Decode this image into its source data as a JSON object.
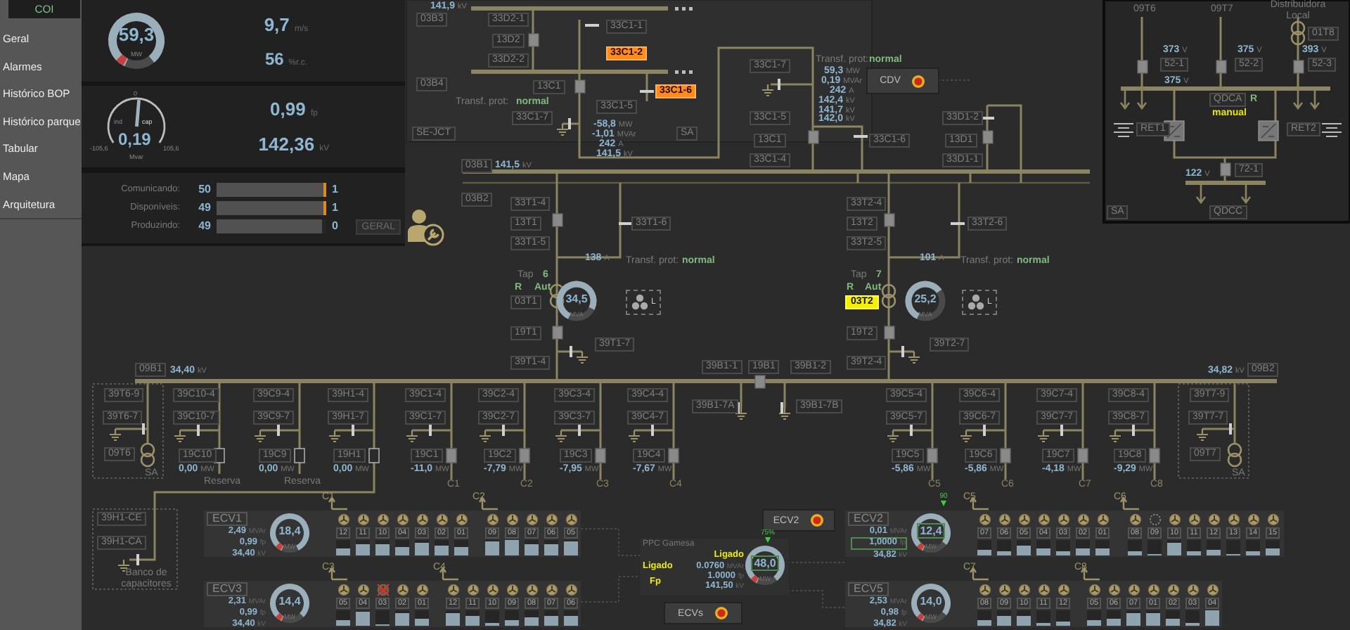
{
  "sidebar": {
    "items": [
      {
        "label": "COI",
        "selected": true
      },
      {
        "label": "Geral",
        "selected": false
      },
      {
        "label": "Alarmes",
        "selected": false
      },
      {
        "label": "Histórico BOP",
        "selected": false
      },
      {
        "label": "Histórico parque",
        "selected": false
      },
      {
        "label": "Tabular",
        "selected": false
      },
      {
        "label": "Mapa",
        "selected": false
      },
      {
        "label": "Arquitetura",
        "selected": false
      }
    ]
  },
  "summary": {
    "power": {
      "value": "59,3",
      "unit": "MW",
      "level": 0.82
    },
    "wind": {
      "value": "9,7",
      "unit": "m/s"
    },
    "capacity": {
      "value": "56",
      "unit": "%r.c."
    },
    "reactive": {
      "value": "0,19",
      "unit": "Mvar",
      "level": 0.52,
      "scale_mid": "0",
      "scale_min": "-105,6",
      "scale_max": "105,6",
      "left_label": "ind",
      "right_label": "cap"
    },
    "power_factor": {
      "value": "0,99",
      "unit": "fp"
    },
    "voltage": {
      "value": "142,36",
      "unit": "kV"
    },
    "turbines": [
      {
        "label": "Comunicando:",
        "count": "50",
        "level": 0.97,
        "alert": true,
        "other": "1"
      },
      {
        "label": "Disponíveis:",
        "count": "49",
        "level": 0.97,
        "alert": true,
        "other": "1"
      },
      {
        "label": "Produzindo:",
        "count": "49",
        "level": 0.96,
        "alert": false,
        "other": "0"
      }
    ],
    "button": "GERAL"
  },
  "diagram": {
    "items": [
      {
        "kind": "value",
        "text": "141,9",
        "unit": "kV"
      },
      {
        "kind": "tag",
        "text": "03B3"
      },
      {
        "kind": "tag",
        "text": "33D2-1"
      },
      {
        "kind": "tag",
        "text": "13D2"
      },
      {
        "kind": "tag",
        "text": "33D2-2"
      },
      {
        "kind": "tag",
        "text": "33C1-1"
      },
      {
        "kind": "alarm",
        "text": "33C1-2"
      },
      {
        "kind": "tag",
        "text": "03B4"
      },
      {
        "kind": "tag",
        "text": "13C1"
      },
      {
        "kind": "alarm",
        "text": "33C1-6"
      },
      {
        "kind": "caption",
        "text": "Transf. prot:"
      },
      {
        "kind": "status",
        "text": "normal"
      },
      {
        "kind": "tag",
        "text": "33C1-5"
      },
      {
        "kind": "tag",
        "text": "33C1-7"
      },
      {
        "kind": "value",
        "text": "-58,8",
        "unit": "MW"
      },
      {
        "kind": "value",
        "text": "-1,01",
        "unit": "MVAr"
      },
      {
        "kind": "value",
        "text": "242",
        "unit": "A"
      },
      {
        "kind": "value",
        "text": "141,5",
        "unit": "kV"
      },
      {
        "kind": "tag",
        "text": "SE-JCT"
      },
      {
        "kind": "tag",
        "text": "SA"
      },
      {
        "kind": "tag",
        "text": "03B1"
      },
      {
        "kind": "value",
        "text": "141,5",
        "unit": "kV"
      },
      {
        "kind": "caption",
        "text": "Transf. prot:"
      },
      {
        "kind": "status",
        "text": "normal"
      },
      {
        "kind": "tag",
        "text": "33C1-7"
      },
      {
        "kind": "value",
        "text": "59,3",
        "unit": "MW"
      },
      {
        "kind": "value",
        "text": "0,19",
        "unit": "MVAr"
      },
      {
        "kind": "value",
        "text": "242",
        "unit": "A"
      },
      {
        "kind": "value",
        "text": "142,4",
        "unit": "kV"
      },
      {
        "kind": "tag",
        "text": "33C1-5"
      },
      {
        "kind": "value",
        "text": "141,7",
        "unit": "kV"
      },
      {
        "kind": "value",
        "text": "142,0",
        "unit": "kV"
      },
      {
        "kind": "tag",
        "text": "33D1-2"
      },
      {
        "kind": "tag",
        "text": "13C1"
      },
      {
        "kind": "tag",
        "text": "33C1-6"
      },
      {
        "kind": "tag",
        "text": "13D1"
      },
      {
        "kind": "tag",
        "text": "33C1-4"
      },
      {
        "kind": "tag",
        "text": "33D1-1"
      },
      {
        "kind": "caption",
        "text": "09T6"
      },
      {
        "kind": "caption",
        "text": "09T7"
      },
      {
        "kind": "caption",
        "text": "Distribuidora Local"
      },
      {
        "kind": "tag",
        "text": "01T8"
      },
      {
        "kind": "value",
        "text": "373",
        "unit": "V"
      },
      {
        "kind": "value",
        "text": "375",
        "unit": "V"
      },
      {
        "kind": "value",
        "text": "393",
        "unit": "V"
      },
      {
        "kind": "tag",
        "text": "52-1"
      },
      {
        "kind": "tag",
        "text": "52-2"
      },
      {
        "kind": "tag",
        "text": "52-3"
      },
      {
        "kind": "value",
        "text": "375",
        "unit": "V"
      },
      {
        "kind": "tag",
        "text": "QDCA"
      },
      {
        "kind": "status",
        "text": "R"
      },
      {
        "kind": "mode",
        "text": "manual"
      },
      {
        "kind": "tag",
        "text": "RET1"
      },
      {
        "kind": "tag",
        "text": "RET2"
      },
      {
        "kind": "value",
        "text": "122",
        "unit": "V"
      },
      {
        "kind": "tag",
        "text": "72-1"
      },
      {
        "kind": "tag",
        "text": "SA"
      },
      {
        "kind": "tag",
        "text": "QDCC"
      },
      {
        "kind": "tag",
        "text": "03B2"
      },
      {
        "kind": "tag",
        "text": "33T1-4"
      },
      {
        "kind": "tag",
        "text": "13T1"
      },
      {
        "kind": "tag",
        "text": "33T1-6"
      },
      {
        "kind": "tag",
        "text": "33T1-5"
      },
      {
        "kind": "value",
        "text": "138",
        "unit": "A"
      },
      {
        "kind": "caption",
        "text": "Transf. prot:"
      },
      {
        "kind": "status",
        "text": "normal"
      },
      {
        "kind": "caption",
        "text": "Tap"
      },
      {
        "kind": "status",
        "text": "6"
      },
      {
        "kind": "status",
        "text": "R"
      },
      {
        "kind": "status",
        "text": "Aut"
      },
      {
        "kind": "tag",
        "text": "03T1"
      },
      {
        "kind": "tag",
        "text": "19T1"
      },
      {
        "kind": "tag",
        "text": "39T1-7"
      },
      {
        "kind": "tag",
        "text": "39T1-4"
      },
      {
        "kind": "tag",
        "text": "33T2-4"
      },
      {
        "kind": "tag",
        "text": "13T2"
      },
      {
        "kind": "tag",
        "text": "33T2-6"
      },
      {
        "kind": "tag",
        "text": "33T2-5"
      },
      {
        "kind": "value",
        "text": "101",
        "unit": "A"
      },
      {
        "kind": "caption",
        "text": "Transf. prot:"
      },
      {
        "kind": "status",
        "text": "normal"
      },
      {
        "kind": "caption",
        "text": "Tap"
      },
      {
        "kind": "status",
        "text": "7"
      },
      {
        "kind": "status",
        "text": "R"
      },
      {
        "kind": "status",
        "text": "Aut"
      },
      {
        "kind": "highlight",
        "text": "03T2"
      },
      {
        "kind": "tag",
        "text": "19T2"
      },
      {
        "kind": "tag",
        "text": "39T2-7"
      },
      {
        "kind": "tag",
        "text": "39T2-4"
      },
      {
        "kind": "tag",
        "text": "09B1"
      },
      {
        "kind": "value",
        "text": "34,40",
        "unit": "kV"
      },
      {
        "kind": "tag",
        "text": "39B1-1"
      },
      {
        "kind": "tag",
        "text": "19B1"
      },
      {
        "kind": "tag",
        "text": "39B1-2"
      },
      {
        "kind": "value",
        "text": "34,82",
        "unit": "kV"
      },
      {
        "kind": "tag",
        "text": "09B2"
      },
      {
        "kind": "tag",
        "text": "39T6-9"
      },
      {
        "kind": "tag",
        "text": "39T6-7"
      },
      {
        "kind": "tag",
        "text": "09T6"
      },
      {
        "kind": "caption",
        "text": "SA"
      },
      {
        "kind": "tag",
        "text": "39B1-7A"
      },
      {
        "kind": "tag",
        "text": "39B1-7B"
      },
      {
        "kind": "tag",
        "text": "39T7-9"
      },
      {
        "kind": "tag",
        "text": "39T7-7"
      },
      {
        "kind": "tag",
        "text": "09T7"
      },
      {
        "kind": "caption",
        "text": "SA"
      },
      {
        "kind": "tag",
        "text": "39H1-CE"
      },
      {
        "kind": "tag",
        "text": "39H1-CA"
      },
      {
        "kind": "caption",
        "text": "Banco de capacitores"
      }
    ],
    "feeders": [
      {
        "tags": [
          "39C10-4",
          "39C10-7",
          "19C10"
        ],
        "reading": {
          "value": "0,00",
          "unit": "MW"
        },
        "closed": false,
        "note": "Reserva"
      },
      {
        "tags": [
          "39C9-4",
          "39C9-7",
          "19C9"
        ],
        "reading": {
          "value": "0,00",
          "unit": "MW"
        },
        "closed": false,
        "note": "Reserva"
      },
      {
        "tags": [
          "39H1-4",
          "39H1-7",
          "19H1"
        ],
        "reading": {
          "value": "0,00",
          "unit": "MW"
        },
        "closed": false
      },
      {
        "tags": [
          "39C1-4",
          "39C1-7",
          "19C1"
        ],
        "reading": {
          "value": "-11,0",
          "unit": "MW"
        },
        "closed": true,
        "bay": "C1"
      },
      {
        "tags": [
          "39C2-4",
          "39C2-7",
          "19C2"
        ],
        "reading": {
          "value": "-7,79",
          "unit": "MW"
        },
        "closed": true,
        "bay": "C2"
      },
      {
        "tags": [
          "39C3-4",
          "39C3-7",
          "19C3"
        ],
        "reading": {
          "value": "-7,95",
          "unit": "MW"
        },
        "closed": true,
        "bay": "C3"
      },
      {
        "tags": [
          "39C4-4",
          "39C4-7",
          "19C4"
        ],
        "reading": {
          "value": "-7,67",
          "unit": "MW"
        },
        "closed": true,
        "bay": "C4"
      },
      {
        "tags": [
          "39C5-4",
          "39C5-7",
          "19C5"
        ],
        "reading": {
          "value": "-5,86",
          "unit": "MW"
        },
        "closed": true,
        "bay": "C5"
      },
      {
        "tags": [
          "39C6-4",
          "39C6-7",
          "19C6"
        ],
        "reading": {
          "value": "-5,86",
          "unit": "MW"
        },
        "closed": true,
        "bay": "C6"
      },
      {
        "tags": [
          "39C7-4",
          "39C7-7",
          "19C7"
        ],
        "reading": {
          "value": "-4,18",
          "unit": "MW"
        },
        "closed": true,
        "bay": "C7"
      },
      {
        "tags": [
          "39C8-4",
          "39C8-7",
          "19C8"
        ],
        "reading": {
          "value": "-9,29",
          "unit": "MW"
        },
        "closed": true,
        "bay": "C8"
      }
    ],
    "transformer_gauges": [
      {
        "value": "34,5",
        "unit": "MVA",
        "level": 0.75
      },
      {
        "value": "25,2",
        "unit": "MVA",
        "level": 0.58
      }
    ],
    "fans": [
      {
        "label": "L"
      },
      {
        "label": "L"
      }
    ],
    "buttons": [
      {
        "label": "CDV"
      },
      {
        "label": "ECV2"
      },
      {
        "label": "ECVs"
      }
    ]
  },
  "ppc": {
    "title": "PPC Gamesa",
    "state": "Ligado",
    "mode_label": "Ligado",
    "control": "Fp",
    "readings": [
      {
        "value": "0.0760",
        "unit": "MVAr"
      },
      {
        "value": "1.0000",
        "unit": "fp"
      },
      {
        "value": "141,50",
        "unit": "kV"
      }
    ],
    "gauge": {
      "value": "48,0",
      "unit": "MW",
      "level": 0.82,
      "setpoint": "75%",
      "controlled": true
    }
  },
  "ecvs": [
    {
      "name": "ECV1",
      "readings": [
        {
          "value": "2,49",
          "unit": "MVAr"
        },
        {
          "value": "0,99",
          "unit": "fp"
        },
        {
          "value": "34,40",
          "unit": "kV"
        }
      ],
      "gauge": {
        "value": "18,4",
        "unit": "MW",
        "level": 0.85,
        "controlled": false
      },
      "groups": [
        {
          "feeder": "C1",
          "turbines": [
            {
              "id": "12",
              "kind": "run",
              "level": 0.5
            },
            {
              "id": "11",
              "kind": "run",
              "level": 0.75
            },
            {
              "id": "10",
              "kind": "run",
              "level": 0.75
            },
            {
              "id": "04",
              "kind": "run",
              "level": 0.55
            },
            {
              "id": "03",
              "kind": "run",
              "level": 0.85
            },
            {
              "id": "02",
              "kind": "run",
              "level": 0.6
            },
            {
              "id": "01",
              "kind": "run",
              "level": 0.55
            }
          ]
        },
        {
          "feeder": "C2",
          "turbines": [
            {
              "id": "09",
              "kind": "run",
              "level": 0.9
            },
            {
              "id": "08",
              "kind": "run",
              "level": 1.0
            },
            {
              "id": "07",
              "kind": "run",
              "level": 0.75
            },
            {
              "id": "06",
              "kind": "run",
              "level": 0.7
            },
            {
              "id": "05",
              "kind": "run",
              "level": 0.9
            }
          ]
        }
      ]
    },
    {
      "name": "ECV2",
      "readings": [
        {
          "value": "0,01",
          "unit": "MVAr",
          "controlled": false
        },
        {
          "value": "1,0000",
          "unit": "fp",
          "controlled": true
        },
        {
          "value": "34,82",
          "unit": "kV",
          "controlled": false
        }
      ],
      "gauge": {
        "value": "12,4",
        "unit": "MW",
        "level": 0.78,
        "setpoint": "90",
        "controlled": true
      },
      "groups": [
        {
          "feeder": "C5",
          "turbines": [
            {
              "id": "07",
              "kind": "run",
              "level": 0.35
            },
            {
              "id": "06",
              "kind": "run",
              "level": 0.25
            },
            {
              "id": "05",
              "kind": "run",
              "level": 0.6
            },
            {
              "id": "04",
              "kind": "run",
              "level": 0.5
            },
            {
              "id": "03",
              "kind": "run",
              "level": 0.3
            },
            {
              "id": "02",
              "kind": "run",
              "level": 0.45
            },
            {
              "id": "01",
              "kind": "run",
              "level": 0.45
            }
          ]
        },
        {
          "feeder": "C6",
          "turbines": [
            {
              "id": "08",
              "kind": "run",
              "level": 0.25
            },
            {
              "id": "09",
              "kind": "offline",
              "level": 0
            },
            {
              "id": "10",
              "kind": "run",
              "level": 0.85
            },
            {
              "id": "11",
              "kind": "run",
              "level": 0.3
            },
            {
              "id": "12",
              "kind": "run",
              "level": 0.4
            },
            {
              "id": "13",
              "kind": "run",
              "level": 0.12
            },
            {
              "id": "14",
              "kind": "run",
              "level": 0.3
            },
            {
              "id": "15",
              "kind": "run",
              "level": 0.5
            }
          ]
        }
      ]
    },
    {
      "name": "ECV3",
      "readings": [
        {
          "value": "2,31",
          "unit": "MVAr"
        },
        {
          "value": "0,99",
          "unit": "fp"
        },
        {
          "value": "34,40",
          "unit": "kV"
        }
      ],
      "gauge": {
        "value": "14,4",
        "unit": "MW",
        "level": 0.8,
        "controlled": false
      },
      "groups": [
        {
          "feeder": "C3",
          "turbines": [
            {
              "id": "05",
              "kind": "run",
              "level": 0.4
            },
            {
              "id": "04",
              "kind": "run",
              "level": 0.9
            },
            {
              "id": "03",
              "kind": "fault",
              "level": 0
            },
            {
              "id": "02",
              "kind": "run",
              "level": 0.8
            },
            {
              "id": "01",
              "kind": "run",
              "level": 0.5
            }
          ]
        },
        {
          "feeder": "C4",
          "turbines": [
            {
              "id": "12",
              "kind": "run",
              "level": 0.8
            },
            {
              "id": "11",
              "kind": "run",
              "level": 0.6
            },
            {
              "id": "10",
              "kind": "run",
              "level": 0.2
            },
            {
              "id": "09",
              "kind": "run",
              "level": 0.4
            },
            {
              "id": "08",
              "kind": "run",
              "level": 0.55
            },
            {
              "id": "07",
              "kind": "run",
              "level": 0.6
            },
            {
              "id": "06",
              "kind": "run",
              "level": 0.65
            }
          ]
        }
      ]
    },
    {
      "name": "ECV5",
      "readings": [
        {
          "value": "2,53",
          "unit": "MVAr"
        },
        {
          "value": "0,98",
          "unit": "fp"
        },
        {
          "value": "34,82",
          "unit": "kV"
        }
      ],
      "gauge": {
        "value": "14,0",
        "unit": "MW",
        "level": 0.78,
        "controlled": false
      },
      "groups": [
        {
          "feeder": "C7",
          "turbines": [
            {
              "id": "08",
              "kind": "run",
              "level": 0.4
            },
            {
              "id": "09",
              "kind": "run",
              "level": 0.6
            },
            {
              "id": "10",
              "kind": "run",
              "level": 0.6
            },
            {
              "id": "11",
              "kind": "run",
              "level": 0.2
            },
            {
              "id": "12",
              "kind": "run",
              "level": 0.3
            }
          ]
        },
        {
          "feeder": "C8",
          "turbines": [
            {
              "id": "05",
              "kind": "run",
              "level": 0.4
            },
            {
              "id": "06",
              "kind": "run",
              "level": 0.5
            },
            {
              "id": "07",
              "kind": "run",
              "level": 0.8
            },
            {
              "id": "01",
              "kind": "run",
              "level": 0.8
            },
            {
              "id": "02",
              "kind": "run",
              "level": 0.5
            },
            {
              "id": "03",
              "kind": "run",
              "level": 0.2
            },
            {
              "id": "04",
              "kind": "run",
              "level": 1.0
            }
          ]
        }
      ]
    }
  ]
}
